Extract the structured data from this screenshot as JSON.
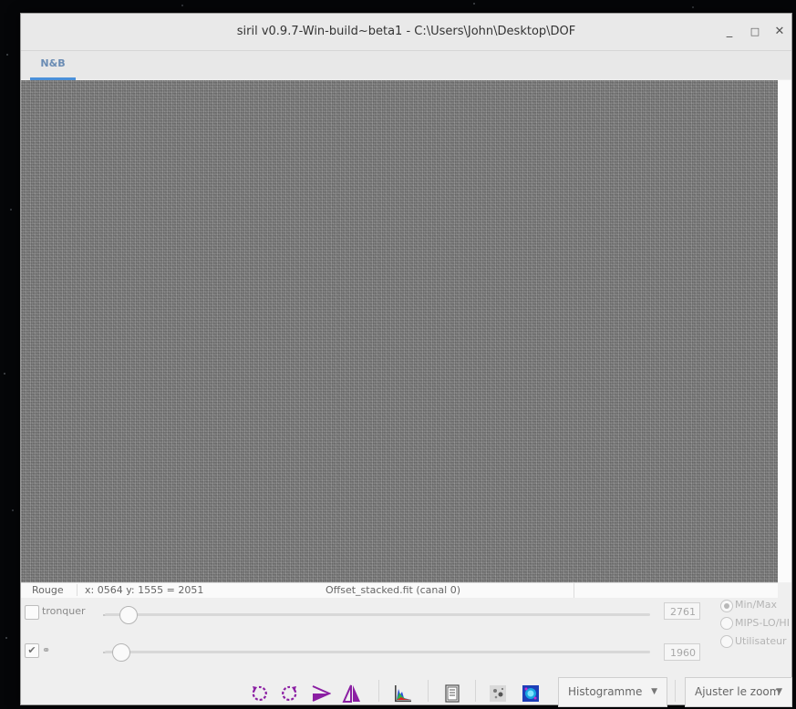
{
  "window": {
    "title": "siril v0.9.7-Win-build~beta1 - C:\\Users\\John\\Desktop\\DOF",
    "minimize": "_",
    "maximize": "□",
    "close": "✕"
  },
  "tabs": [
    {
      "label": "N&B",
      "active": true
    }
  ],
  "status": {
    "channel": "Rouge",
    "coords": "x: 0564 y: 1555 = 2051",
    "file": "Offset_stacked.fit (canal 0)"
  },
  "controls": {
    "tronquer_label": "tronquer",
    "tronquer_checked": false,
    "link_checked": true,
    "link_icon": "link-icon",
    "high_value": "2761",
    "low_value": "1960",
    "high_slider_level": 0.04,
    "low_slider_level": 0.02,
    "scale_modes": [
      {
        "label": "Min/Max",
        "selected": true
      },
      {
        "label": "MIPS-LO/HI",
        "selected": false
      },
      {
        "label": "Utilisateur",
        "selected": false
      }
    ]
  },
  "toolbar": {
    "icons": [
      "rotate-ccw-icon",
      "rotate-cw-icon",
      "mirror-x-icon",
      "mirror-y-icon",
      "histogram-icon",
      "fits-header-icon",
      "negative-view-icon",
      "false-color-icon"
    ],
    "display_mode": "Histogramme",
    "zoom": "Ajuster le zoom"
  },
  "colors": {
    "accent": "#4a90d9",
    "icon_purple": "#8b1fa3",
    "viewport_gray": "#7c7c7c"
  }
}
